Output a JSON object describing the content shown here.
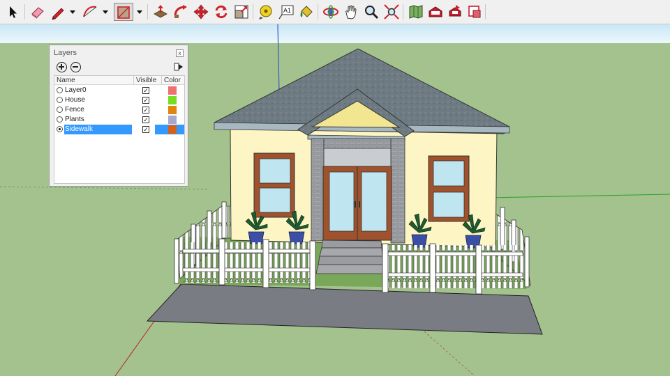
{
  "toolbar": {
    "tools": [
      {
        "name": "select-tool",
        "icon": "arrow-icon"
      },
      {
        "name": "eraser-tool",
        "icon": "eraser-icon"
      },
      {
        "name": "pencil-tool",
        "icon": "pencil-icon"
      },
      {
        "name": "arc-tool",
        "icon": "arc-icon"
      },
      {
        "name": "rectangle-tool",
        "icon": "rectangle-icon"
      },
      {
        "name": "push-pull-tool",
        "icon": "push-pull-icon"
      },
      {
        "name": "follow-me-tool",
        "icon": "follow-me-icon"
      },
      {
        "name": "move-tool",
        "icon": "move-icon"
      },
      {
        "name": "rotate-tool",
        "icon": "rotate-icon"
      },
      {
        "name": "scale-tool",
        "icon": "scale-icon"
      },
      {
        "name": "tape-measure-tool",
        "icon": "tape-measure-icon"
      },
      {
        "name": "text-tool",
        "icon": "text-icon",
        "label": "A1"
      },
      {
        "name": "paint-bucket-tool",
        "icon": "paint-bucket-icon"
      },
      {
        "name": "orbit-tool",
        "icon": "orbit-icon"
      },
      {
        "name": "pan-tool",
        "icon": "hand-icon"
      },
      {
        "name": "zoom-tool",
        "icon": "magnifier-icon"
      },
      {
        "name": "zoom-extents-tool",
        "icon": "zoom-extents-icon"
      },
      {
        "name": "add-location-tool",
        "icon": "map-icon"
      },
      {
        "name": "3d-warehouse-tool",
        "icon": "warehouse-icon"
      },
      {
        "name": "share-model-tool",
        "icon": "share-model-icon"
      },
      {
        "name": "extension-warehouse-tool",
        "icon": "extension-warehouse-icon"
      }
    ]
  },
  "layers_panel": {
    "title": "Layers",
    "close_label": "x",
    "columns": {
      "name": "Name",
      "visible": "Visible",
      "color": "Color"
    },
    "layers": [
      {
        "name": "Layer0",
        "visible": true,
        "active": false,
        "selected": false,
        "color": "#f07070"
      },
      {
        "name": "House",
        "visible": true,
        "active": false,
        "selected": false,
        "color": "#77dd22"
      },
      {
        "name": "Fence",
        "visible": true,
        "active": false,
        "selected": false,
        "color": "#e0860e"
      },
      {
        "name": "Plants",
        "visible": true,
        "active": false,
        "selected": false,
        "color": "#a8a8cc"
      },
      {
        "name": "Sidewalk",
        "visible": true,
        "active": true,
        "selected": true,
        "color": "#d96018"
      }
    ]
  },
  "colors": {
    "sky": "#e3f3fb",
    "ground": "#a3c28d",
    "roof": "#6b7a80",
    "wall": "#fdf6c4",
    "trim": "#a8b8c0",
    "door_frame": "#a0522d",
    "glass": "#bfe6f0",
    "sidewalk": "#7a7c84",
    "lawn": "#7aa85a",
    "fence": "#ffffff"
  }
}
